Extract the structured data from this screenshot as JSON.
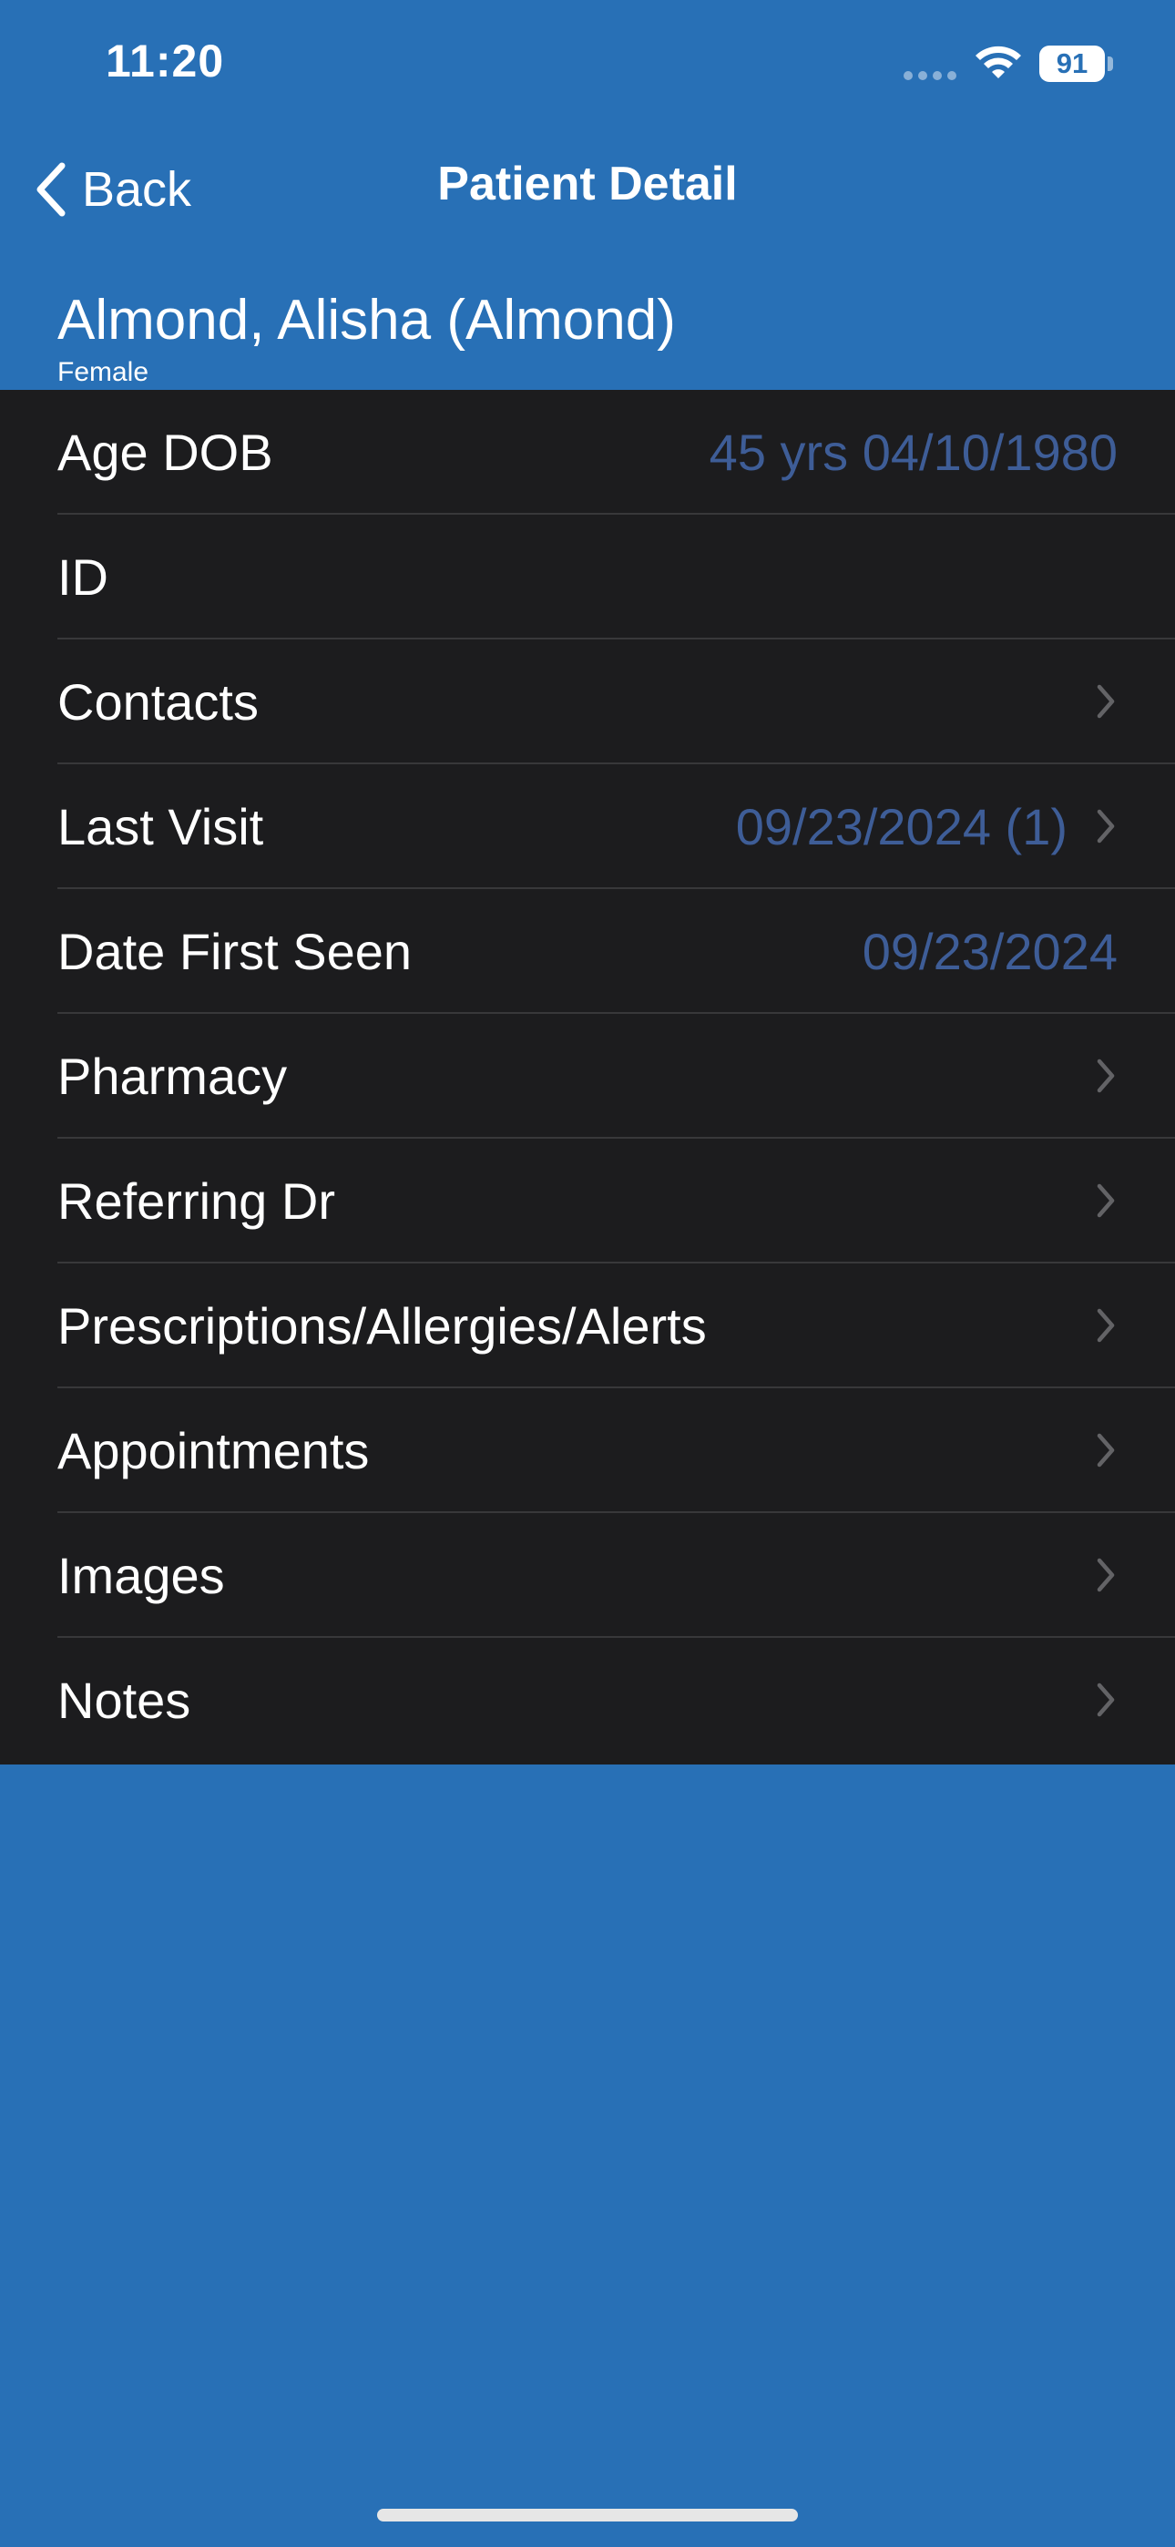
{
  "status_bar": {
    "time": "11:20",
    "battery": "91"
  },
  "nav": {
    "back_label": "Back",
    "title": "Patient Detail"
  },
  "patient": {
    "name": "Almond, Alisha (Almond)",
    "gender": "Female"
  },
  "rows": [
    {
      "label": "Age DOB",
      "value": "45 yrs  04/10/1980",
      "chevron": false
    },
    {
      "label": "ID",
      "value": "",
      "chevron": false
    },
    {
      "label": "Contacts",
      "value": "",
      "chevron": true
    },
    {
      "label": "Last Visit",
      "value": "09/23/2024 (1)",
      "chevron": true
    },
    {
      "label": "Date First Seen",
      "value": "09/23/2024",
      "chevron": false
    },
    {
      "label": "Pharmacy",
      "value": "",
      "chevron": true
    },
    {
      "label": "Referring Dr",
      "value": "",
      "chevron": true
    },
    {
      "label": "Prescriptions/Allergies/Alerts",
      "value": "",
      "chevron": true
    },
    {
      "label": "Appointments",
      "value": "",
      "chevron": true
    },
    {
      "label": "Images",
      "value": "",
      "chevron": true
    },
    {
      "label": "Notes",
      "value": "",
      "chevron": true
    }
  ],
  "colors": {
    "background": "#2870b6",
    "list_background": "#1c1c1e",
    "value_text": "#3e5d97",
    "chevron": "#636366"
  },
  "icons": {
    "back": "chevron-left-icon",
    "row_disclosure": "chevron-right-icon",
    "wifi": "wifi-icon",
    "battery": "battery-icon",
    "signal": "cellular-signal-icon"
  }
}
